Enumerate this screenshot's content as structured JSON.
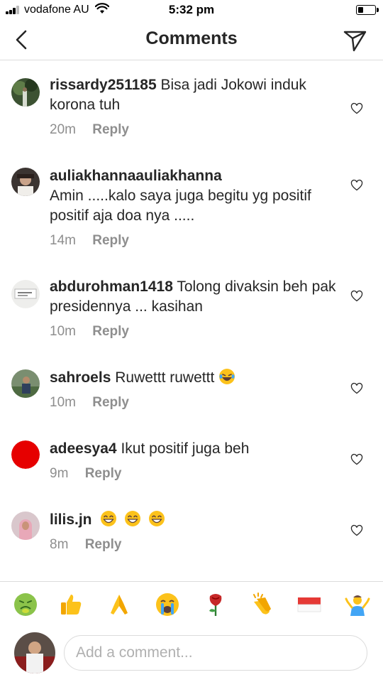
{
  "status": {
    "carrier": "vodafone AU",
    "time": "5:32 pm",
    "battery_level": 0.3
  },
  "header": {
    "title": "Comments",
    "back_icon": "chevron-left-icon",
    "send_icon": "paper-plane-icon"
  },
  "comments": [
    {
      "user": "rissardy251185",
      "text": "Bisa jadi Jokowi induk korona tuh",
      "time": "20m",
      "reply": "Reply",
      "avatar": "forest-photo"
    },
    {
      "user": "auliakhannaauliakhanna",
      "text": "Amin .....kalo saya juga begitu yg positif positif aja doa nya .....",
      "time": "14m",
      "reply": "Reply",
      "avatar": "portrait-photo"
    },
    {
      "user": "abdurohman1418",
      "text": "Tolong divaksin beh pak presidennya ... kasihan",
      "time": "10m",
      "reply": "Reply",
      "avatar": "sign-photo"
    },
    {
      "user": "sahroels",
      "text": "Ruwettt ruwettt",
      "emoji": "laughing-crying-emoji",
      "time": "10m",
      "reply": "Reply",
      "avatar": "outdoor-photo"
    },
    {
      "user": "adeesya4",
      "text": "Ikut positif juga beh",
      "time": "9m",
      "reply": "Reply",
      "avatar": "red-circle",
      "avatar_color": "#e60000"
    },
    {
      "user": "lilis.jn",
      "text": "",
      "emoji": "grinning-emoji x3",
      "time": "8m",
      "reply": "Reply",
      "avatar": "hijab-photo"
    }
  ],
  "emoji_bar": [
    "nauseated-face-emoji",
    "thumbs-up-emoji",
    "folded-hands-emoji",
    "crying-face-emoji",
    "rose-emoji",
    "clapping-hands-emoji",
    "indonesia-flag-emoji",
    "shrugging-person-emoji"
  ],
  "composer": {
    "placeholder": "Add a comment..."
  },
  "colors": {
    "text": "#262626",
    "muted": "#8e8e8e",
    "divider": "#dbdbdb",
    "accent_red": "#e60000"
  }
}
